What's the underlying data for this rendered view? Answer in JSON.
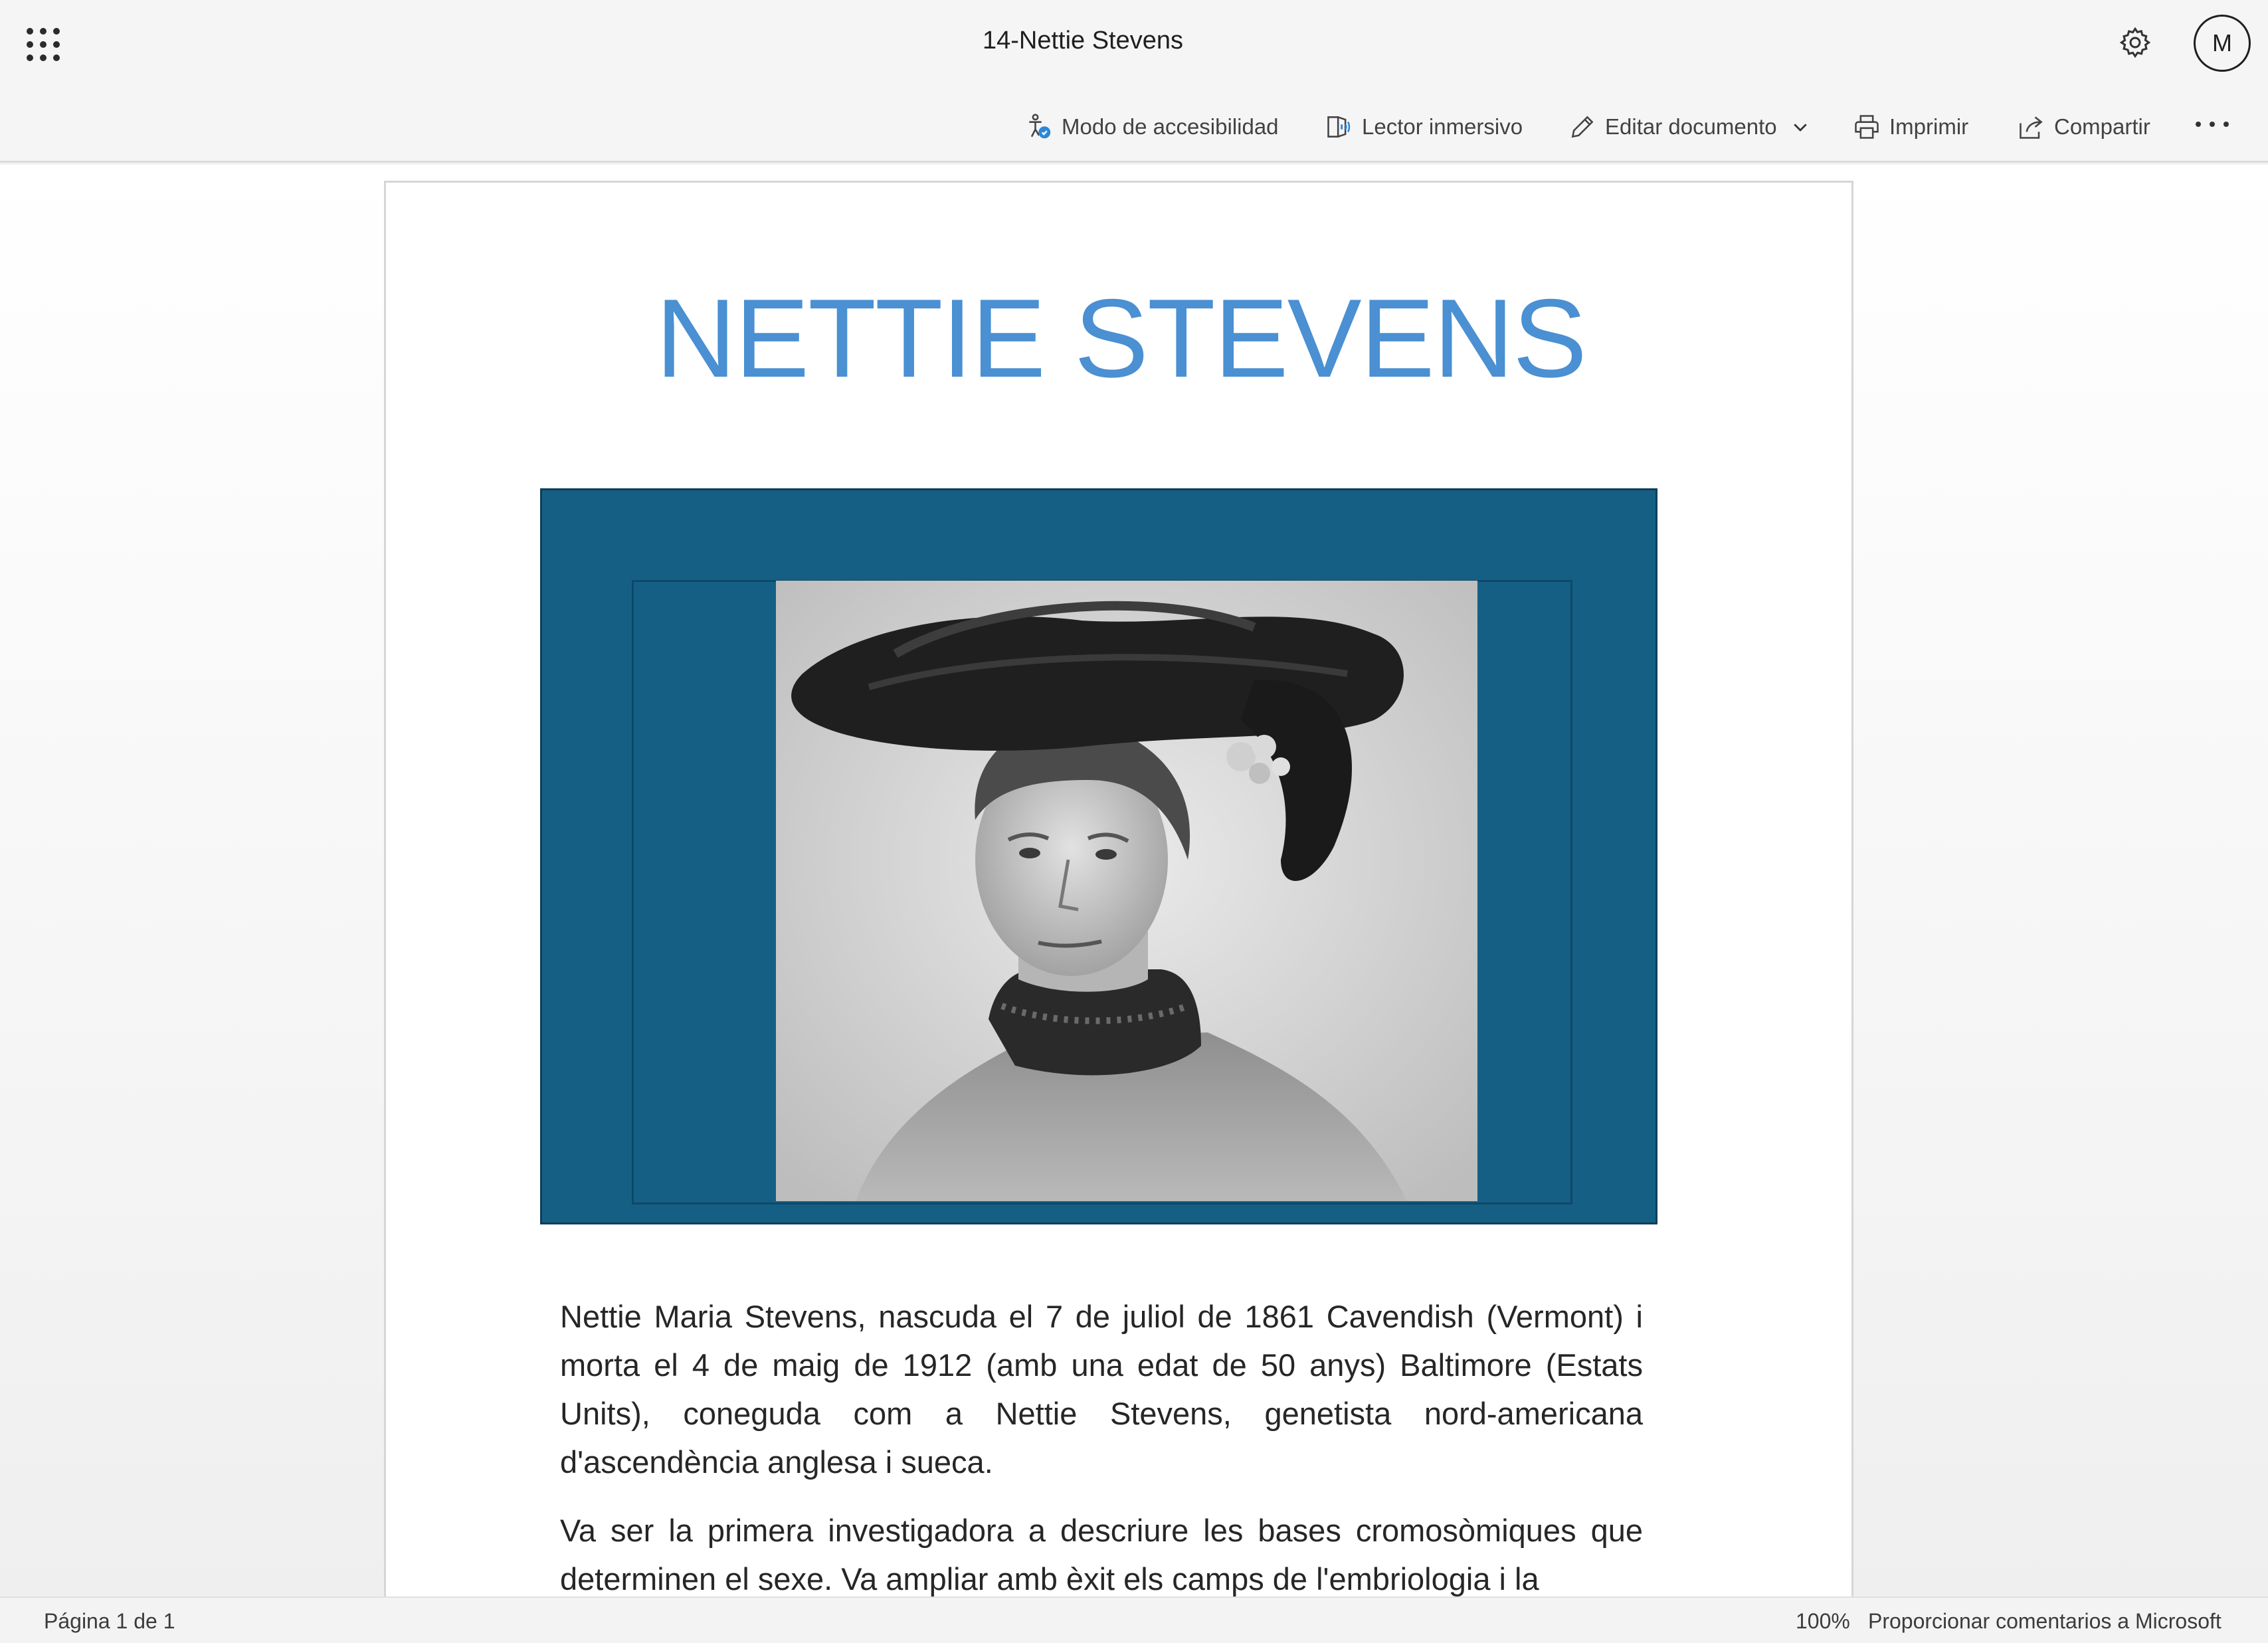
{
  "header": {
    "doc_title": "14-Nettie Stevens",
    "avatar_initial": "M"
  },
  "commands": {
    "accessibility": "Modo de accesibilidad",
    "immersive_reader": "Lector inmersivo",
    "edit_document": "Editar documento",
    "print": "Imprimir",
    "share": "Compartir"
  },
  "icons": {
    "apps": "waffle-icon",
    "settings": "gear-icon",
    "accessibility": "accessibility-icon",
    "immersive_reader": "immersive-reader-icon",
    "edit": "pencil-icon",
    "print": "printer-icon",
    "share": "share-icon",
    "more": "more-icon"
  },
  "document": {
    "heading": "NETTIE STEVENS",
    "paragraphs": [
      "Nettie Maria Stevens, nascuda el 7 de juliol de 1861 Cavendish (Vermont) i morta el 4 de maig de 1912 (amb una edat de 50 anys) Baltimore (Estats Units), coneguda com a Nettie Stevens, genetista nord-americana d'ascendència anglesa i sueca.",
      "Va ser la primera investigadora a descriure les bases cromosòmiques que determinen el sexe. Va ampliar amb èxit els camps de l'embriologia i la"
    ]
  },
  "colors": {
    "heading": "#4a90d2",
    "figure_background": "#155f85",
    "accent_icon": "#2b88d8"
  },
  "status": {
    "page": "Página 1 de 1",
    "zoom": "100%",
    "feedback": "Proporcionar comentarios a Microsoft"
  }
}
